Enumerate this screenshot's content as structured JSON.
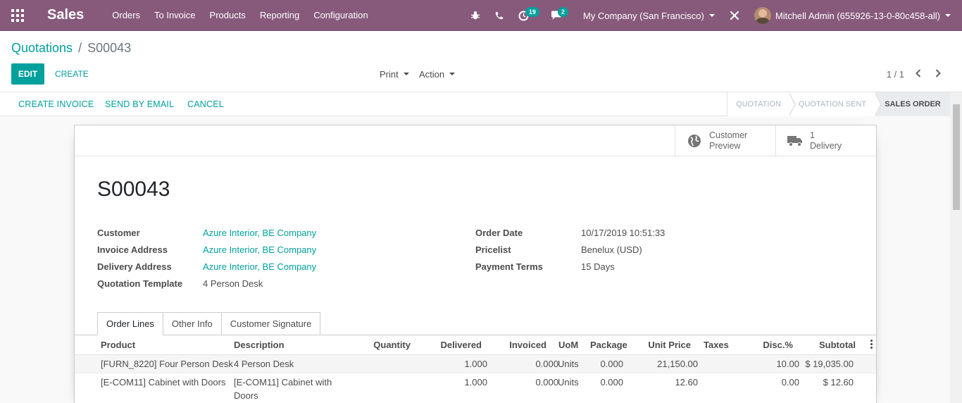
{
  "navbar": {
    "app_name": "Sales",
    "menu": [
      "Orders",
      "To Invoice",
      "Products",
      "Reporting",
      "Configuration"
    ],
    "activity_count": "19",
    "message_count": "2",
    "company": "My Company (San Francisco)",
    "user": "Mitchell Admin (655926-13-0-80c458-all)",
    "accent_color": "#875a7b"
  },
  "breadcrumb": {
    "parent": "Quotations",
    "separator": "/",
    "current": "S00043"
  },
  "toolbar": {
    "edit_label": "EDIT",
    "create_label": "CREATE",
    "print_label": "Print",
    "action_label": "Action",
    "pager": "1 / 1"
  },
  "statusbar": {
    "buttons": [
      "CREATE INVOICE",
      "SEND BY EMAIL",
      "CANCEL"
    ],
    "stages": [
      "QUOTATION",
      "QUOTATION SENT",
      "SALES ORDER"
    ],
    "active_stage": "SALES ORDER"
  },
  "button_box": {
    "preview_line1": "Customer",
    "preview_line2": "Preview",
    "delivery_count": "1",
    "delivery_label": "Delivery"
  },
  "order": {
    "name": "S00043",
    "left": [
      {
        "label": "Customer",
        "value": "Azure Interior, BE Company"
      },
      {
        "label": "Invoice Address",
        "value": "Azure Interior, BE Company"
      },
      {
        "label": "Delivery Address",
        "value": "Azure Interior, BE Company"
      },
      {
        "label": "Quotation Template",
        "value": "4 Person Desk"
      }
    ],
    "right": [
      {
        "label": "Order Date",
        "value": "10/17/2019 10:51:33"
      },
      {
        "label": "Pricelist",
        "value": "Benelux (USD)"
      },
      {
        "label": "Payment Terms",
        "value": "15 Days"
      }
    ]
  },
  "tabs": [
    "Order Lines",
    "Other Info",
    "Customer Signature"
  ],
  "order_lines": {
    "columns": [
      "Product",
      "Description",
      "Quantity",
      "Delivered",
      "Invoiced",
      "UoM",
      "Package",
      "Unit Price",
      "Taxes",
      "Disc.%",
      "Subtotal"
    ],
    "rows": [
      {
        "product": "[FURN_8220] Four Person Desk",
        "description": "4 Person Desk",
        "description2": "",
        "quantity": "1.000",
        "delivered": "0.000",
        "invoiced": "0.000",
        "uom": "Units",
        "package": "",
        "unit_price": "21,150.00",
        "taxes": "",
        "discount": "10.00",
        "subtotal": "$ 19,035.00"
      },
      {
        "product": "[E-COM11] Cabinet with Doors",
        "description": "[E-COM11] Cabinet with",
        "description2": "Doors",
        "quantity": "1.000",
        "delivered": "0.000",
        "invoiced": "0.000",
        "uom": "Units",
        "package": "",
        "unit_price": "12.60",
        "taxes": "",
        "discount": "0.00",
        "subtotal": "$ 12.60"
      }
    ]
  }
}
